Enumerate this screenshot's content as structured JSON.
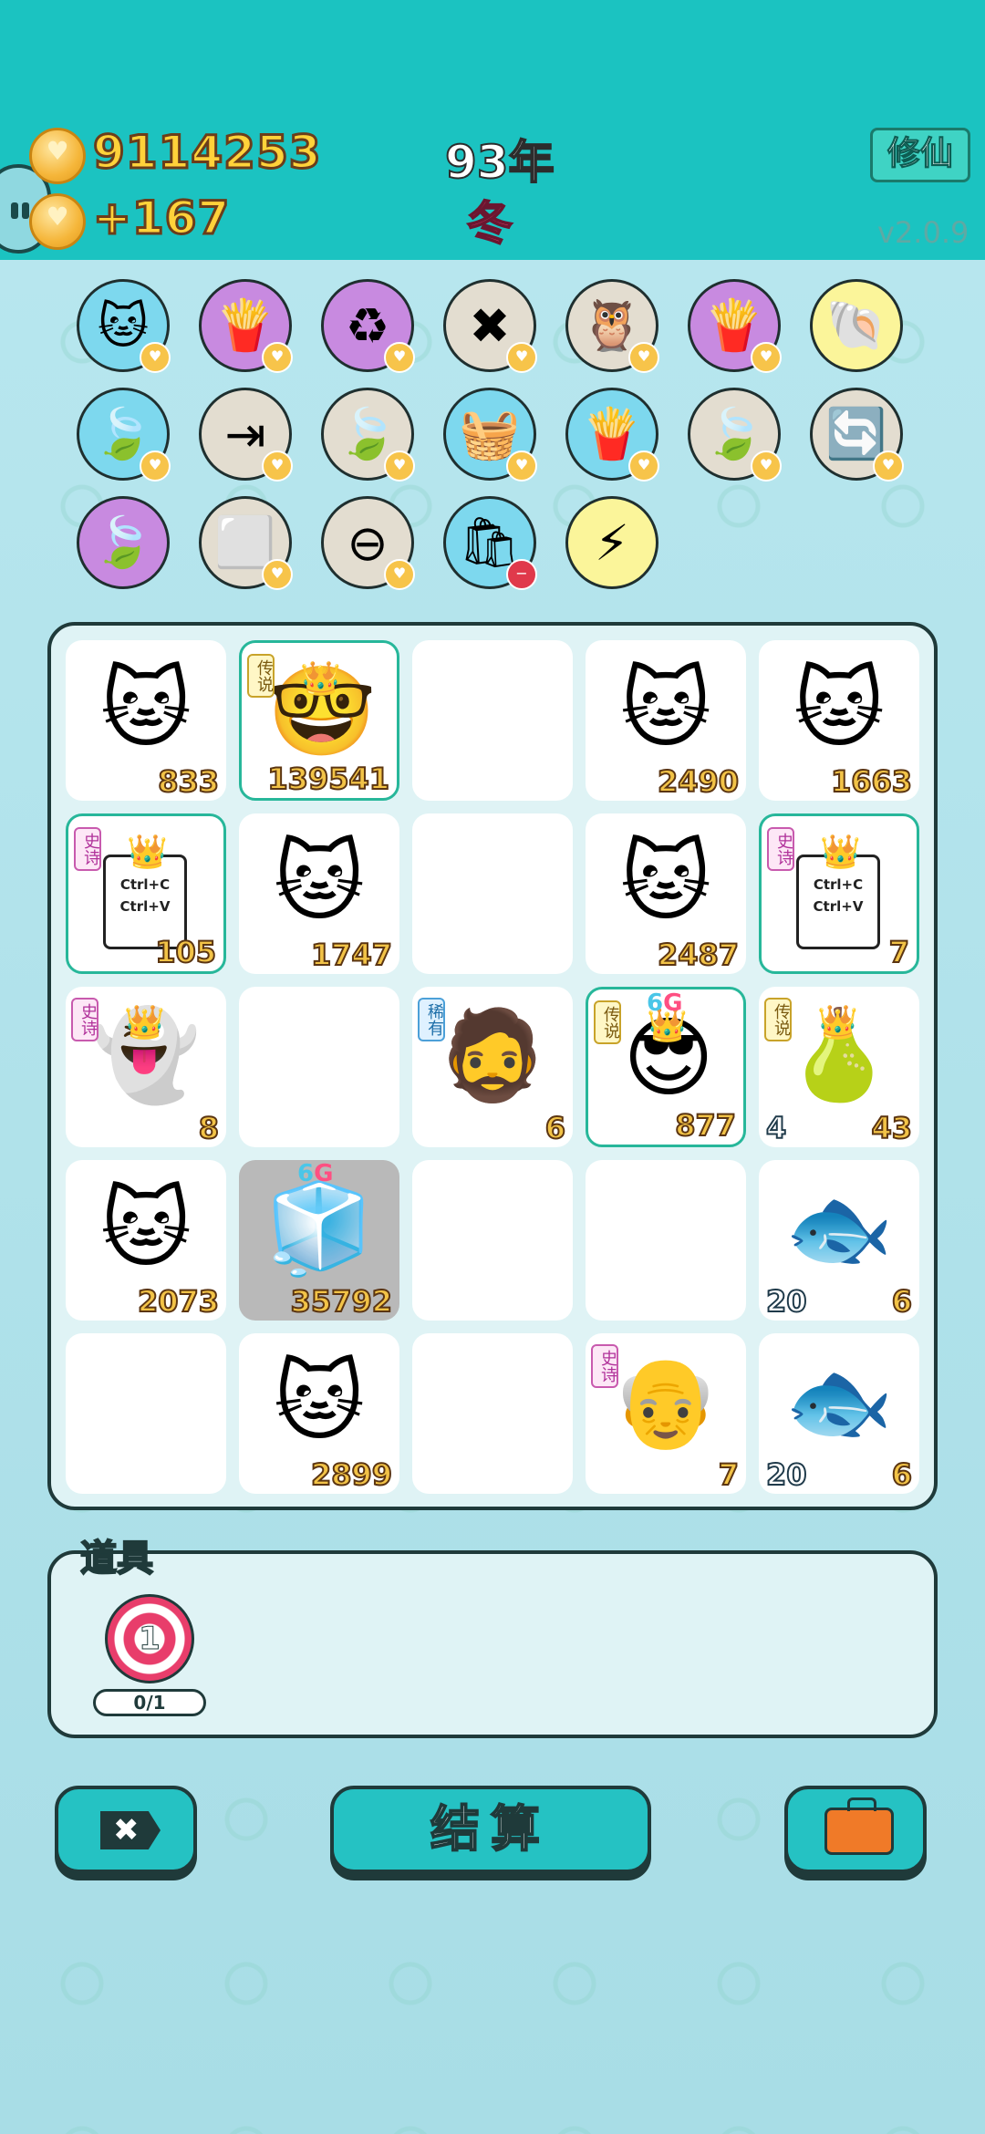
{
  "header": {
    "coins": "9114253",
    "income": "+167",
    "year": "93年",
    "season": "冬",
    "mode_button": "修仙",
    "version": "v2.0.9"
  },
  "skills": [
    {
      "icon": "cat-icon",
      "glyph": "🐱",
      "color": "c-blue"
    },
    {
      "icon": "fries-icon",
      "glyph": "🍟",
      "color": "c-purple"
    },
    {
      "icon": "recycle-icon",
      "glyph": "♻",
      "color": "c-purple"
    },
    {
      "icon": "delete-tag-icon",
      "glyph": "✖",
      "color": "c-gray"
    },
    {
      "icon": "owl-pair-icon",
      "glyph": "🦉",
      "color": "c-gray"
    },
    {
      "icon": "fries-icon",
      "glyph": "🍟",
      "color": "c-purple"
    },
    {
      "icon": "shell-icon",
      "glyph": "🐚",
      "color": "c-yellow"
    },
    {
      "icon": "leaf-icon",
      "glyph": "🍃",
      "color": "c-blue"
    },
    {
      "icon": "skip-icon",
      "glyph": "⇥",
      "color": "c-gray"
    },
    {
      "icon": "leaf-icon",
      "glyph": "🍃",
      "color": "c-gray"
    },
    {
      "icon": "fruit-basket-icon",
      "glyph": "🧺",
      "color": "c-blue"
    },
    {
      "icon": "fries-icon",
      "glyph": "🍟",
      "color": "c-blue"
    },
    {
      "icon": "leaf-icon",
      "glyph": "🍃",
      "color": "c-gray"
    },
    {
      "icon": "refresh-icon",
      "glyph": "🔄",
      "color": "c-gray"
    },
    {
      "icon": "leaf-icon",
      "glyph": "🍃",
      "color": "c-purple"
    },
    {
      "icon": "blocks-icon",
      "glyph": "⬜",
      "color": "c-gray"
    },
    {
      "icon": "minus-circle-icon",
      "glyph": "⊖",
      "color": "c-gray"
    },
    {
      "icon": "sack-icon",
      "glyph": "🛍",
      "color": "c-blue"
    },
    {
      "icon": "lightning-icon",
      "glyph": "⚡",
      "color": "c-yellow"
    }
  ],
  "board": {
    "cells": [
      {
        "art": "🐱",
        "name": "cat",
        "value": "833"
      },
      {
        "art": "🤓",
        "name": "grandpa-king",
        "value": "139541",
        "tag": "传说",
        "tag_type": "legend",
        "crown": true,
        "selected": true
      },
      {
        "empty": true
      },
      {
        "art": "🐱",
        "name": "cat",
        "value": "2490"
      },
      {
        "art": "🐱",
        "name": "cat",
        "value": "1663"
      },
      {
        "copy": true,
        "name": "copy-paste-card",
        "value": "105",
        "tag": "史诗",
        "tag_type": "epic",
        "crown": true,
        "selected": true
      },
      {
        "art": "🐱",
        "name": "cat",
        "value": "1747"
      },
      {
        "empty": true
      },
      {
        "art": "🐱",
        "name": "cat",
        "value": "2487"
      },
      {
        "copy": true,
        "name": "copy-paste-card",
        "value": "7",
        "tag": "史诗",
        "tag_type": "epic",
        "crown": true,
        "selected": true
      },
      {
        "art": "👻",
        "name": "ghost",
        "value": "8",
        "tag": "史诗",
        "tag_type": "epic",
        "crown": true
      },
      {
        "empty": true
      },
      {
        "art": "🧔",
        "name": "bucket-hat-man",
        "value": "6",
        "tag": "稀有",
        "tag_type": "rare"
      },
      {
        "art": "😎",
        "name": "sunglasses-man",
        "value": "877",
        "tag": "传说",
        "tag_type": "legend",
        "crown": true,
        "selected": true,
        "label6g": true
      },
      {
        "art": "🍐",
        "name": "pear",
        "value": "43",
        "value_left": "4",
        "tag": "传说",
        "tag_type": "legend",
        "crown": true
      },
      {
        "art": "🐱",
        "name": "cat",
        "value": "2073"
      },
      {
        "art": "🧊",
        "name": "fridge",
        "value": "35792",
        "gray": true,
        "label6g": true
      },
      {
        "empty": true
      },
      {
        "empty": true
      },
      {
        "art": "🐟",
        "name": "fish",
        "value": "6",
        "value_left": "20"
      },
      {
        "empty": true
      },
      {
        "art": "🐱",
        "name": "cat",
        "value": "2899"
      },
      {
        "empty": true
      },
      {
        "art": "👴",
        "name": "old-man",
        "value": "7",
        "tag": "史诗",
        "tag_type": "epic"
      },
      {
        "art": "🐟",
        "name": "fish",
        "value": "6",
        "value_left": "20"
      }
    ],
    "copy_line1": "Ctrl+C",
    "copy_line2": "Ctrl+V",
    "label_6": "6",
    "label_g": "G"
  },
  "items": {
    "title": "道具",
    "target_count": "1",
    "usage": "0/1"
  },
  "buttons": {
    "settle": "结算",
    "discard_glyph": "✖"
  }
}
